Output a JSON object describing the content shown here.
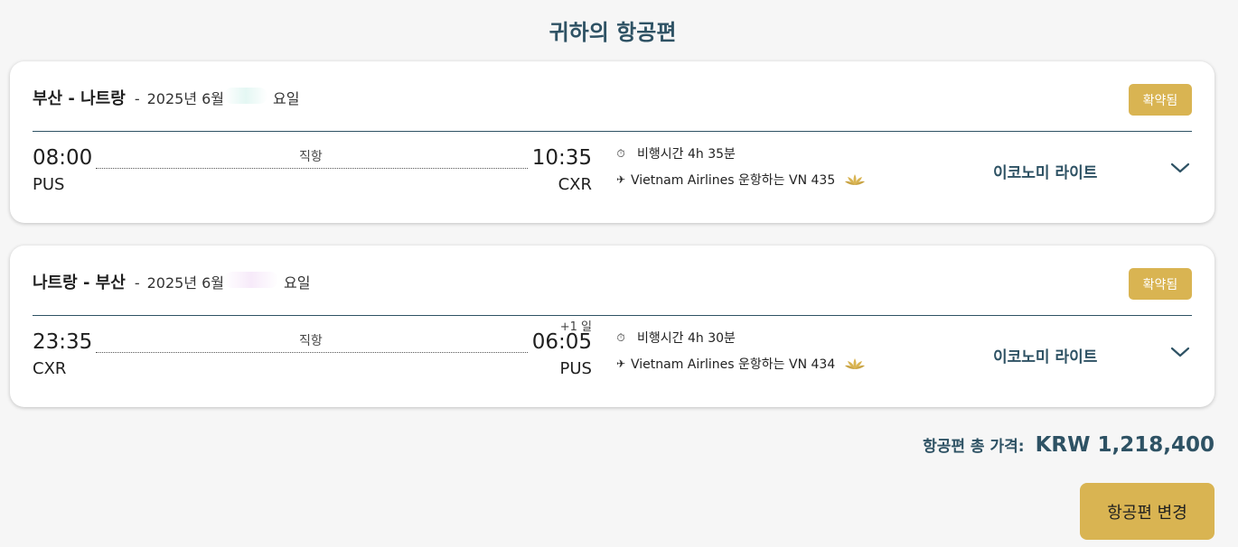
{
  "page": {
    "title": "귀하의 항공편"
  },
  "flights": [
    {
      "route": "부산 - 나트랑",
      "separator": "-",
      "date": "2025년 6월",
      "weekday": "요일",
      "status": "확약됨",
      "departure": {
        "time": "08:00",
        "code": "PUS"
      },
      "arrival": {
        "time": "10:35",
        "code": "CXR",
        "day_offset": ""
      },
      "stops": "직항",
      "duration": "비행시간 4h 35분",
      "operated_by": "Vietnam Airlines 운항하는 VN 435",
      "cabin": "이코노미 라이트",
      "icons": {
        "duration": "stopwatch-icon",
        "airline": "plane-icon",
        "carrier_logo": "lotus-logo-icon",
        "expand": "chevron-down-icon"
      }
    },
    {
      "route": "나트랑 - 부산",
      "separator": "-",
      "date": "2025년 6월",
      "weekday": "요일",
      "status": "확약됨",
      "departure": {
        "time": "23:35",
        "code": "CXR"
      },
      "arrival": {
        "time": "06:05",
        "code": "PUS",
        "day_offset": "+1 일"
      },
      "stops": "직항",
      "duration": "비행시간 4h 30분",
      "operated_by": "Vietnam Airlines 운항하는 VN 434",
      "cabin": "이코노미 라이트",
      "icons": {
        "duration": "stopwatch-icon",
        "airline": "plane-icon",
        "carrier_logo": "lotus-logo-icon",
        "expand": "chevron-down-icon"
      }
    }
  ],
  "total": {
    "label": "항공편 총 가격:",
    "value": "KRW 1,218,400"
  },
  "actions": {
    "change_label": "항공편 변경"
  },
  "colors": {
    "accent_gold": "#d9b452",
    "brand_teal": "#2e5264",
    "background": "#f6f6f6"
  }
}
